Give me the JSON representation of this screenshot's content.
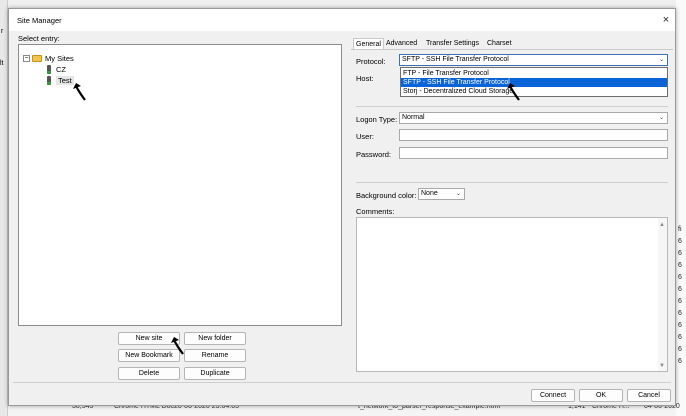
{
  "window": {
    "title": "Site Manager",
    "close_icon": "×"
  },
  "left": {
    "select_entry_label": "Select entry:",
    "tree": {
      "root": {
        "label": "My Sites",
        "expander": "−"
      },
      "children": [
        {
          "label": "CZ"
        },
        {
          "label": "Test"
        }
      ]
    },
    "buttons": {
      "new_site": "New site",
      "new_folder": "New folder",
      "new_bookmark": "New Bookmark",
      "rename": "Rename",
      "delete": "Delete",
      "duplicate": "Duplicate"
    }
  },
  "tabs": [
    "General",
    "Advanced",
    "Transfer Settings",
    "Charset"
  ],
  "general": {
    "protocol_label": "Protocol:",
    "protocol_value": "SFTP - SSH File Transfer Protocol",
    "protocol_options": [
      "FTP - File Transfer Protocol",
      "SFTP - SSH File Transfer Protocol",
      "Storj - Decentralized Cloud Storage"
    ],
    "host_label": "Host:",
    "logon_type_label": "Logon Type:",
    "logon_type_value": "Normal",
    "user_label": "User:",
    "password_label": "Password:",
    "background_color_label": "Background color:",
    "background_color_value": "None",
    "comments_label": "Comments:"
  },
  "footer": {
    "connect": "Connect",
    "ok": "OK",
    "cancel": "Cancel"
  },
  "background_fragments": {
    "left_chars": [
      "r",
      "lt"
    ],
    "right_chars": [
      "fi",
      "6",
      "6",
      "6",
      "6",
      "6",
      "6",
      "6",
      "6",
      "6",
      "6",
      "6"
    ],
    "bottom": [
      "30,545",
      "Chrome HTML Doc",
      "20-06-2020 23:04:05",
      "t_network_to_parser_response_example.html",
      "1,141",
      "Chrome H...",
      "04-06-2020"
    ]
  },
  "colors": {
    "selection": "#0a64d8",
    "focus_border": "#3b6fb6",
    "folder": "#f3c34b"
  }
}
